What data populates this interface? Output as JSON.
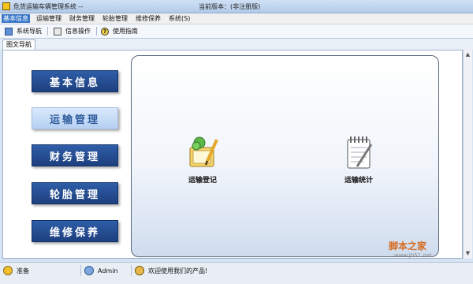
{
  "window": {
    "title": "危货运输车辆管理系统 --",
    "version": "当前版本：(非注册版)"
  },
  "menu": [
    "基本信息",
    "运输管理",
    "财务管理",
    "轮胎管理",
    "维修保养",
    "系统(S)"
  ],
  "toolbar": {
    "items": [
      {
        "label": "系统导航",
        "icon": "monitor-icon"
      },
      {
        "label": "信息操作",
        "icon": "window-icon"
      },
      {
        "label": "使用指南",
        "icon": "help-icon"
      }
    ]
  },
  "tab": {
    "label": "图文导航"
  },
  "nav_buttons": [
    "基本信息",
    "运输管理",
    "财务管理",
    "轮胎管理",
    "维修保养"
  ],
  "active_nav": "运输管理",
  "functions": [
    {
      "label": "运输登记",
      "icon": "register-pencil-icon"
    },
    {
      "label": "运输统计",
      "icon": "notebook-stats-icon"
    }
  ],
  "status": {
    "ready": "准备",
    "user": "Admin",
    "message": "欢迎使用我们的产品!"
  },
  "watermark": {
    "text": "脚本之家",
    "url": "www.jb51.net"
  },
  "colors": {
    "nav_button": "#1d3f7e",
    "nav_active": "#b6d0f2",
    "menu_active": "#3b78c8"
  }
}
